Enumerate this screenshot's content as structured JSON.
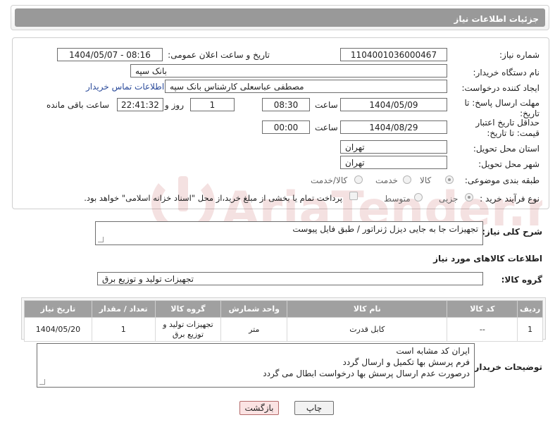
{
  "header": {
    "title": "جزئیات اطلاعات نیاز"
  },
  "form": {
    "need_number": {
      "label": "شماره نیاز:",
      "value": "1104001036000467"
    },
    "announce_datetime": {
      "label": "تاریخ و ساعت اعلان عمومی:",
      "value": "1404/05/07 - 08:16"
    },
    "buyer_org": {
      "label": "نام دستگاه خریدار:",
      "value": "بانک سپه"
    },
    "requester": {
      "label": "ایجاد کننده درخواست:",
      "value": "مصطفی عباسعلی کارشناس بانک سپه",
      "contact_link": "اطلاعات تماس خریدار"
    },
    "reply_deadline": {
      "label": "مهلت ارسال پاسخ: تا تاریخ:",
      "date": "1404/05/09",
      "time_label": "ساعت",
      "time": "08:30",
      "days": "1",
      "days_label": "روز و",
      "remaining": "22:41:32",
      "remaining_label": "ساعت باقی مانده"
    },
    "price_validity": {
      "label": "حداقل تاریخ اعتبار قیمت: تا تاریخ:",
      "date": "1404/08/29",
      "time_label": "ساعت",
      "time": "00:00"
    },
    "delivery_province": {
      "label": "استان محل تحویل:",
      "value": "تهران"
    },
    "delivery_city": {
      "label": "شهر محل تحویل:",
      "value": "تهران"
    },
    "category": {
      "label": "طبقه بندی موضوعی:",
      "options": [
        "کالا",
        "خدمت",
        "کالا/خدمت"
      ],
      "selected": "کالا"
    },
    "purchase_type": {
      "label": "نوع فرآیند خرید :",
      "options": [
        "جزیی",
        "متوسط"
      ],
      "selected": "جزیی",
      "payment_note": "پرداخت تمام یا بخشی از مبلغ خرید،از محل \"اسناد خزانه اسلامی\" خواهد بود."
    }
  },
  "general_description": {
    "label": "شرح کلی نیاز:",
    "value": "تجهیزات جا به جایی دیزل ژنراتور / طبق فایل پیوست"
  },
  "goods_section": {
    "title": "اطلاعات کالاهای مورد نیاز",
    "group_label": "گروه کالا:",
    "group_value": "تجهیزات تولید و توزیع برق"
  },
  "table": {
    "columns": [
      "ردیف",
      "کد کالا",
      "نام کالا",
      "واحد شمارش",
      "گروه کالا",
      "تعداد / مقدار",
      "تاریخ نیاز"
    ],
    "rows": [
      [
        "1",
        "--",
        "کابل قدرت",
        "متر",
        "تجهیزات تولید و توزیع برق",
        "1",
        "1404/05/20"
      ]
    ]
  },
  "buyer_notes": {
    "label": "توضیحات خریدار:",
    "lines": [
      "ایران کد مشابه است",
      "فرم پرسش بها تکمیل و ارسال گردد",
      "درصورت عدم ارسال پرسش بها درخواست ابطال می گردد"
    ]
  },
  "buttons": {
    "print": "چاپ",
    "back": "بازگشت"
  },
  "watermark": {
    "text": "AriaTender.neT"
  },
  "colors": {
    "header": "#999999",
    "table_header": "#a0a0a0",
    "back_button": "#fbe3e3",
    "link": "#2a4a9a"
  }
}
